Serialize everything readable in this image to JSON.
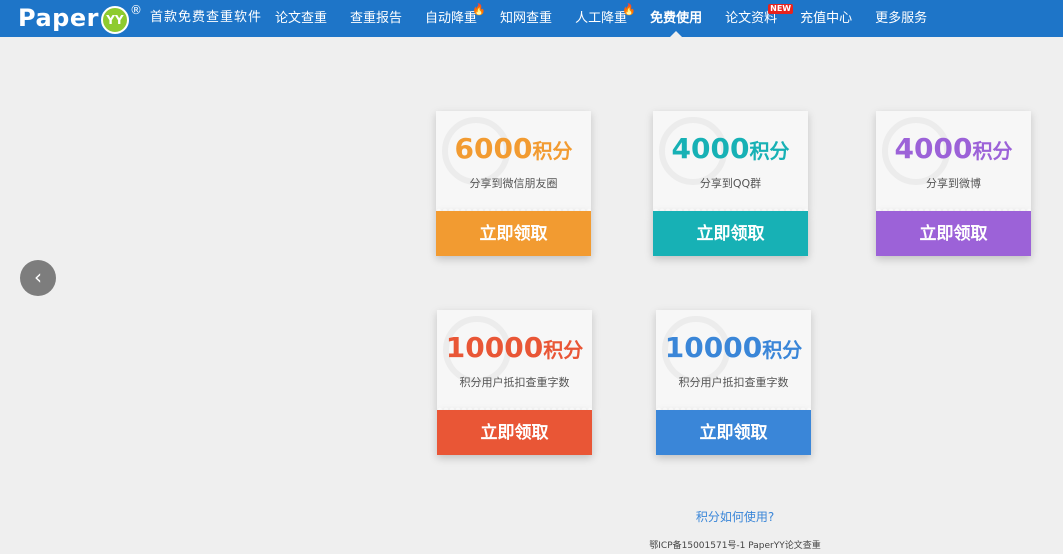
{
  "header": {
    "logo_text": "Paper",
    "logo_badge": "YY",
    "logo_reg": "®",
    "tagline": "首款免费查重软件",
    "nav": [
      {
        "label": "论文查重",
        "badge": ""
      },
      {
        "label": "查重报告",
        "badge": ""
      },
      {
        "label": "自动降重",
        "badge": "hot"
      },
      {
        "label": "知网查重",
        "badge": ""
      },
      {
        "label": "人工降重",
        "badge": "hot"
      },
      {
        "label": "免费使用",
        "badge": "",
        "active": true
      },
      {
        "label": "论文资料",
        "badge": "NEW"
      },
      {
        "label": "充值中心",
        "badge": ""
      },
      {
        "label": "更多服务",
        "badge": ""
      }
    ],
    "colors": {
      "nav_bg": "#1e75c8",
      "hot_icon": "flame-icon"
    }
  },
  "carousel": {
    "prev_icon": "chevron-left-icon",
    "prev_glyph": "‹"
  },
  "cards": [
    {
      "points": "6000",
      "unit": "积分",
      "desc": "分享到微信朋友圈",
      "button": "立即领取",
      "color": "#f29b31"
    },
    {
      "points": "4000",
      "unit": "积分",
      "desc": "分享到QQ群",
      "button": "立即领取",
      "color": "#17b1b5"
    },
    {
      "points": "4000",
      "unit": "积分",
      "desc": "分享到微博",
      "button": "立即领取",
      "color": "#9c62d8"
    },
    {
      "points": "10000",
      "unit": "积分",
      "desc": "积分用户抵扣查重字数",
      "button": "立即领取",
      "color": "#e95636"
    },
    {
      "points": "10000",
      "unit": "积分",
      "desc": "积分用户抵扣查重字数",
      "button": "立即领取",
      "color": "#3a86d8"
    }
  ],
  "footer": {
    "how_to_use": "积分如何使用?",
    "icp": "鄂ICP备15001571号-1 PaperYY论文查重"
  }
}
